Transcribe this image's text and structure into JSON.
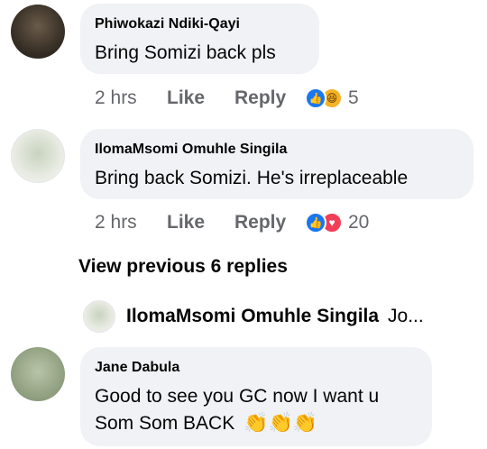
{
  "comments": [
    {
      "author": "Phiwokazi Ndiki-Qayi",
      "text": "Bring Somizi back pls",
      "time": "2 hrs",
      "like_label": "Like",
      "reply_label": "Reply",
      "reactions": [
        "like",
        "haha"
      ],
      "reaction_count": "5"
    },
    {
      "author": "IlomaMsomi Omuhle Singila",
      "text": "Bring back Somizi. He's irreplaceable",
      "time": "2 hrs",
      "like_label": "Like",
      "reply_label": "Reply",
      "reactions": [
        "like",
        "love"
      ],
      "reaction_count": "20"
    }
  ],
  "view_previous": "View previous 6 replies",
  "collapsed_reply": {
    "author": "IlomaMsomi Omuhle Singila",
    "snippet": "Jo..."
  },
  "last_comment": {
    "author": "Jane Dabula",
    "line1": "Good to see you GC now I want u",
    "line2": "Som Som BACK",
    "emoji": "👏👏👏"
  },
  "colors": {
    "bubble": "#f0f2f5",
    "meta_text": "#65676b",
    "like_blue": "#1877f2",
    "love_red": "#f33e58",
    "haha_yellow": "#f7b125"
  }
}
